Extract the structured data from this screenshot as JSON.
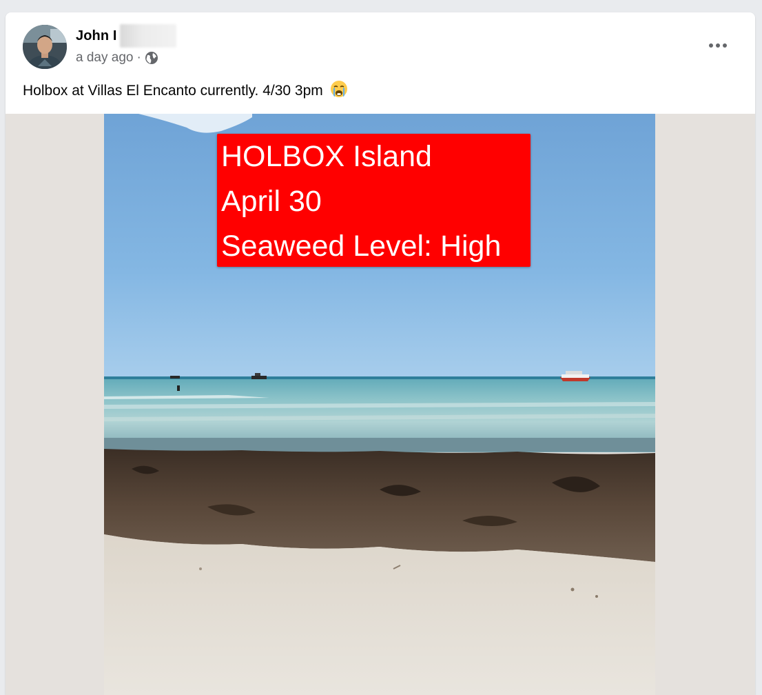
{
  "post": {
    "author_name": "John I",
    "timestamp": "a day ago",
    "separator": "·",
    "audience_icon": "globe-icon",
    "text": "Holbox at Villas El Encanto currently. 4/30 3pm",
    "emoji": "crying-face-emoji",
    "more_icon": "more-horizontal-icon"
  },
  "photo": {
    "overlay": {
      "line1": "HOLBOX Island",
      "line2": "April 30",
      "line3": "Seaweed Level: High"
    },
    "overlay_color": "#ff0000"
  }
}
